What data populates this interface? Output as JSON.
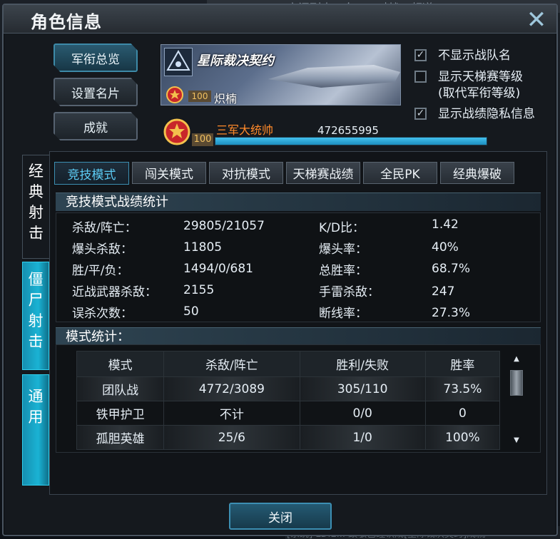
{
  "background": {
    "top_text": "房间列表  /  东PVP对战1-频道6",
    "bottom_text": "[系统] LDIE... 致敬已经认成[星际裁决契约]成就"
  },
  "dialog": {
    "title": "角色信息",
    "close_icon": "close-icon"
  },
  "side_buttons": {
    "rank_overview": "军衔总览",
    "set_card": "设置名片",
    "achievements": "成就"
  },
  "banner": {
    "title": "星际裁决契约",
    "level": "100",
    "player_name": "炽楠"
  },
  "rank": {
    "level": "100",
    "name": "三军大统帅",
    "xp": "472655995",
    "xp_progress": 1.0
  },
  "options": [
    {
      "label": "不显示战队名",
      "checked": true,
      "mark": "✓"
    },
    {
      "label": "显示天梯赛等级\n(取代军衔等级)",
      "checked": false,
      "mark": ""
    },
    {
      "label": "显示战绩隐私信息",
      "checked": true,
      "mark": "✓"
    }
  ],
  "vertical_tabs": {
    "classic": "经典射击",
    "zombie": "僵尸射击",
    "general": "通用"
  },
  "mode_tabs": [
    "竞技模式",
    "闯关模式",
    "对抗模式",
    "天梯赛战绩",
    "全民PK",
    "经典爆破"
  ],
  "stats_section": {
    "title": "竞技模式战绩统计",
    "left": [
      {
        "label": "杀敌/阵亡：",
        "value": "29805/21057"
      },
      {
        "label": "爆头杀敌：",
        "value": "11805"
      },
      {
        "label": "胜/平/负：",
        "value": "1494/0/681"
      },
      {
        "label": "近战武器杀敌：",
        "value": "2155"
      },
      {
        "label": "误杀次数：",
        "value": "50"
      }
    ],
    "right": [
      {
        "label": "K/D比：",
        "value": "1.42"
      },
      {
        "label": "爆头率：",
        "value": "40%"
      },
      {
        "label": "总胜率：",
        "value": "68.7%"
      },
      {
        "label": "手雷杀敌：",
        "value": "247"
      },
      {
        "label": "断线率：",
        "value": "27.3%"
      }
    ]
  },
  "mode_section": {
    "title": "模式统计：",
    "headers": [
      "模式",
      "杀敌/阵亡",
      "胜利/失败",
      "胜率"
    ],
    "rows": [
      [
        "团队战",
        "4772/3089",
        "305/110",
        "73.5%"
      ],
      [
        "铁甲护卫",
        "不计",
        "0/0",
        "0"
      ],
      [
        "孤胆英雄",
        "25/6",
        "1/0",
        "100%"
      ]
    ],
    "scroll_up": "▲",
    "scroll_down": "▼"
  },
  "footer": {
    "close_label": "关闭"
  },
  "colors": {
    "accent": "#5ccbf4",
    "rank_name": "#ff8a2a",
    "xp_bar": "#1d8fc0"
  }
}
